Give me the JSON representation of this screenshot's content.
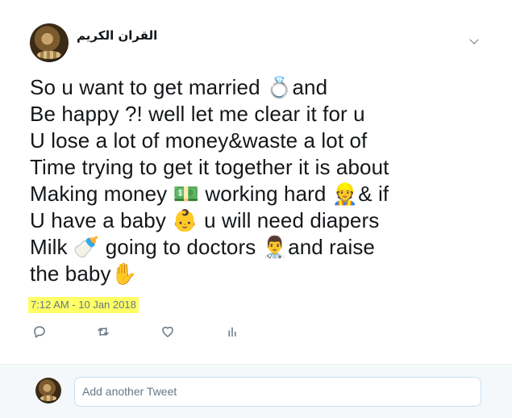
{
  "tweet": {
    "username": "القران الكريم",
    "lines": [
      "So u want to get married 💍and",
      "Be happy ?! well let me clear it for u",
      "U lose a lot of money&waste a lot of",
      "Time trying to get it together it is about",
      "Making money 💵 working hard 👷& if",
      "U have a baby 👶 u will need diapers",
      "Milk 🍼 going to doctors 👨‍⚕️and raise",
      "the baby✋"
    ],
    "timestamp": "7:12 AM - 10 Jan 2018"
  },
  "actions": {
    "icons": [
      "reply-icon",
      "retweet-icon",
      "like-icon",
      "analytics-icon"
    ]
  },
  "reply": {
    "placeholder": "Add another Tweet"
  },
  "colors": {
    "icon_gray": "#657786",
    "highlight": "#ffff66",
    "input_border": "#c2dff5"
  }
}
